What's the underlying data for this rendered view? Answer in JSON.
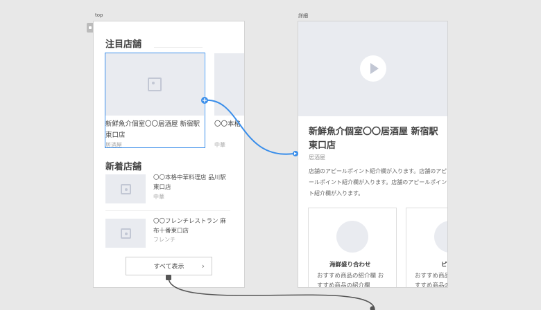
{
  "artboards": {
    "top_label": "top",
    "detail_label": "詳細"
  },
  "top": {
    "featured_title": "注目店舗",
    "featured_cards": [
      {
        "name": "新鮮魚介個室〇〇居酒屋 新宿駅東口店",
        "category": "居酒屋"
      },
      {
        "name": "〇〇本格",
        "category": "中華"
      }
    ],
    "new_title": "新着店舗",
    "new_items": [
      {
        "name": "〇〇本格中華料理店 品川駅東口店",
        "category": "中華"
      },
      {
        "name": "〇〇フレンチレストラン 麻布十番東口店",
        "category": "フレンチ"
      }
    ],
    "see_all": "すべて表示",
    "see_all_chevron": "›"
  },
  "detail": {
    "title": "新鮮魚介個室〇〇居酒屋 新宿駅東口店",
    "category": "居酒屋",
    "description": "店舗のアピールポイント紹介欄が入ります。店舗のアピールポイント紹介欄が入ります。店舗のアピールポイント紹介欄が入ります。",
    "recommendations": [
      {
        "title": "海鮮盛り合わせ",
        "desc": "おすすめ商品の紹介欄 おすすめ商品の紹介欄"
      },
      {
        "title": "ピ",
        "desc": "おすすめ商品の紹介欄 おすすめ商品の紹介欄"
      }
    ]
  },
  "icons": {
    "image_placeholder": "image-icon",
    "play": "play-icon",
    "home": "home-icon",
    "link_anchor": "plus-icon"
  },
  "colors": {
    "canvas": "#e8e8e8",
    "placeholder": "#e9ebf0",
    "prototype_link": "#3a8eea",
    "connector": "#555555"
  }
}
